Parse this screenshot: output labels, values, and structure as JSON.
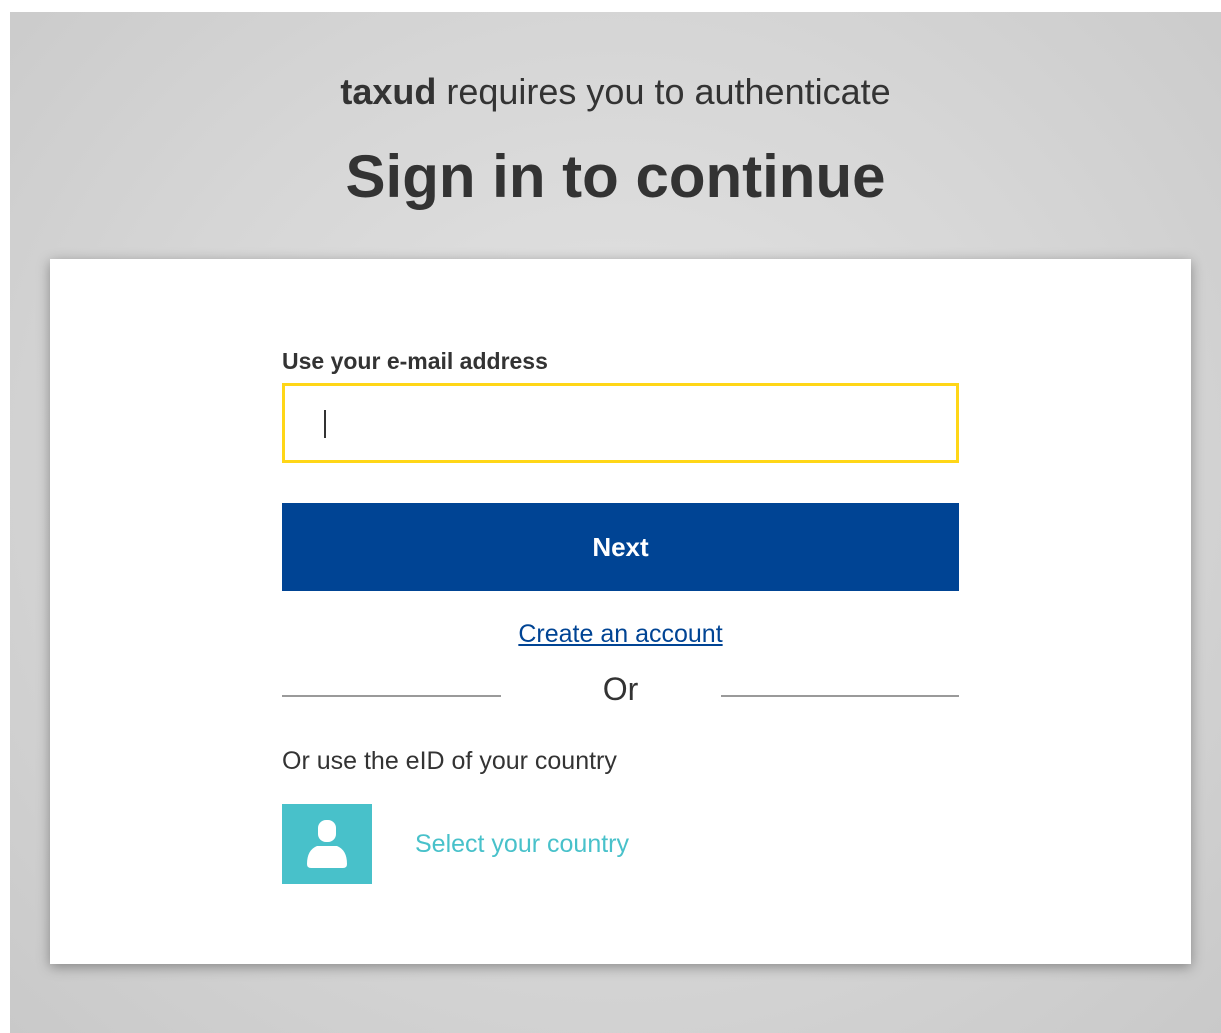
{
  "header": {
    "app_name": "taxud",
    "subtitle_suffix": " requires you to authenticate",
    "title": "Sign in to continue"
  },
  "login_form": {
    "email_label": "Use your e-mail address",
    "email_value": "",
    "next_label": "Next",
    "create_account_label": "Create an account",
    "or_label": "Or",
    "eid_label": "Or use the eID of your country",
    "select_country_label": "Select your country"
  },
  "colors": {
    "primary_button": "#004494",
    "input_focus_border": "#ffd617",
    "eid_accent": "#48c1ca"
  },
  "icons": {
    "country_icon": "user-icon"
  }
}
